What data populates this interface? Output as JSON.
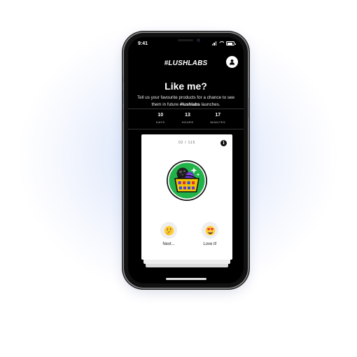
{
  "status_bar": {
    "time": "9:41"
  },
  "header": {
    "logo": "#LUSHLABS",
    "profile_icon": "user-icon"
  },
  "intro": {
    "title": "Like me?",
    "subtitle_pre": "Tell us your favourite products for a chance to see them in future ",
    "subtitle_bold": "#lushlabs",
    "subtitle_post": " launches."
  },
  "countdown": [
    {
      "value": "10",
      "label": "DAYS"
    },
    {
      "value": "13",
      "label": "HOURS"
    },
    {
      "value": "17",
      "label": "MINUTES"
    }
  ],
  "card": {
    "counter": "02 / 115",
    "info_icon": "info-icon",
    "product_image": "shopping-basket-illustration",
    "colors": {
      "badge_green": "#21b34a",
      "basket_yellow": "#f5c400",
      "bath_bomb_purple": "#6b2fd3"
    }
  },
  "actions": {
    "next": {
      "label": "Next...",
      "icon": "thinking-face-icon"
    },
    "love": {
      "label": "Love it!",
      "icon": "heart-eyes-face-icon"
    }
  }
}
